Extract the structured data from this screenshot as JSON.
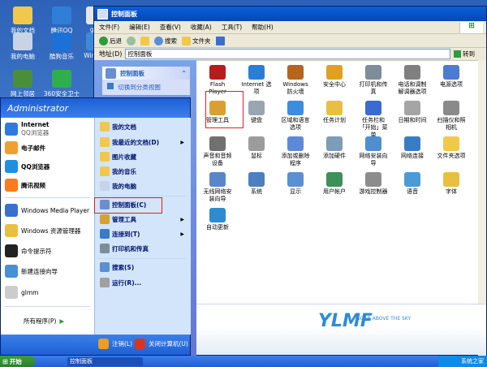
{
  "desktop": {
    "icons": [
      {
        "label": "我的文档",
        "color": "#f1c84b"
      },
      {
        "label": "腾讯QQ",
        "color": "#2f7ed8"
      },
      {
        "label": "我的电脑",
        "color": "#c8d4e6"
      },
      {
        "label": "酷狗音乐",
        "color": "#1a72d6"
      },
      {
        "label": "Window",
        "color": "#3d8ad6"
      },
      {
        "label": "网上邻居",
        "color": "#4a8e3c"
      },
      {
        "label": "360安全卫士",
        "color": "#2fae4e"
      },
      {
        "label": "glm",
        "color": "#e6e6e6"
      }
    ]
  },
  "window": {
    "title": "控制面板",
    "menu": [
      "文件(F)",
      "编辑(E)",
      "查看(V)",
      "收藏(A)",
      "工具(T)",
      "帮助(H)"
    ],
    "toolbar": {
      "back": "后退",
      "search": "搜索",
      "folders": "文件夹"
    },
    "address": {
      "label": "地址(D)",
      "value": "控制面板",
      "go": "转到"
    },
    "taskpane": {
      "title": "控制面板",
      "link": "切换到分类视图"
    },
    "items": [
      {
        "label": "Flash Player",
        "color": "#b71c1c"
      },
      {
        "label": "Internet 选项",
        "color": "#2a7fd4"
      },
      {
        "label": "Windows 防火墙",
        "color": "#b5651d"
      },
      {
        "label": "安全中心",
        "color": "#e0a020"
      },
      {
        "label": "打印机和传真",
        "color": "#7f8c99"
      },
      {
        "label": "电话和调制解调器选项",
        "color": "#808080"
      },
      {
        "label": "电源选项",
        "color": "#4c7bd1"
      },
      {
        "label": "管理工具",
        "color": "#d8a030"
      },
      {
        "label": "键盘",
        "color": "#9aa5b1"
      },
      {
        "label": "区域和语言选项",
        "color": "#3c8de0"
      },
      {
        "label": "任务计划",
        "color": "#e8c040"
      },
      {
        "label": "任务栏和「开始」菜单",
        "color": "#3b6ad0"
      },
      {
        "label": "日期和时间",
        "color": "#a5a5a5"
      },
      {
        "label": "扫描仪和照相机",
        "color": "#8a8a8a"
      },
      {
        "label": "声音和音频设备",
        "color": "#707070"
      },
      {
        "label": "鼠标",
        "color": "#9c9c9c"
      },
      {
        "label": "添加或删除程序",
        "color": "#5d8ad6"
      },
      {
        "label": "添加硬件",
        "color": "#7d9cb8"
      },
      {
        "label": "网络安装向导",
        "color": "#4f8fd0"
      },
      {
        "label": "网络连接",
        "color": "#3a7bc8"
      },
      {
        "label": "文件夹选项",
        "color": "#f0c84a"
      },
      {
        "label": "无线网络安装向导",
        "color": "#5a86c9"
      },
      {
        "label": "系统",
        "color": "#4e7fbe"
      },
      {
        "label": "显示",
        "color": "#5b8fd4"
      },
      {
        "label": "用户帐户",
        "color": "#3e8f5a"
      },
      {
        "label": "游戏控制器",
        "color": "#8c8c8c"
      },
      {
        "label": "语音",
        "color": "#4b9bd6"
      },
      {
        "label": "字体",
        "color": "#e8c040"
      },
      {
        "label": "自动更新",
        "color": "#2f8bd0"
      }
    ],
    "banner": {
      "logo": "YLMF",
      "tagline": "SOAR ABOVE THE SKY"
    }
  },
  "startmenu": {
    "user": "Administrator",
    "left": [
      {
        "label": "Internet",
        "sub": "QQ浏览器",
        "color": "#2d7be0"
      },
      {
        "label": "电子邮件",
        "sub": "",
        "color": "#f0a030"
      },
      {
        "label": "QQ浏览器",
        "sub": "",
        "color": "#1f8fe0"
      },
      {
        "label": "腾讯视频",
        "sub": "",
        "color": "#ff7a1a"
      },
      {
        "label": "Windows Media Player",
        "sub": "",
        "color": "#3a6fcf"
      },
      {
        "label": "Windows 资源管理器",
        "sub": "",
        "color": "#e8c040"
      },
      {
        "label": "命令提示符",
        "sub": "",
        "color": "#222222"
      },
      {
        "label": "新建连接向导",
        "sub": "",
        "color": "#4a8ed4"
      },
      {
        "label": "glmm",
        "sub": "",
        "color": "#cccccc"
      }
    ],
    "all_programs": "所有程序(P)",
    "right": [
      {
        "label": "我的文档",
        "arrow": false,
        "color": "#f1c84b"
      },
      {
        "label": "我最近的文档(D)",
        "arrow": true,
        "color": "#f1c84b"
      },
      {
        "label": "图片收藏",
        "arrow": false,
        "color": "#f1c84b"
      },
      {
        "label": "我的音乐",
        "arrow": false,
        "color": "#f1c84b"
      },
      {
        "label": "我的电脑",
        "arrow": false,
        "color": "#c8d4e6"
      },
      {
        "label": "控制面板(C)",
        "arrow": false,
        "color": "#6a8fd0"
      },
      {
        "label": "管理工具",
        "arrow": true,
        "color": "#d8a030"
      },
      {
        "label": "连接到(T)",
        "arrow": true,
        "color": "#3a7bc8"
      },
      {
        "label": "打印机和传真",
        "arrow": false,
        "color": "#7f8c99"
      },
      {
        "label": "搜索(S)",
        "arrow": false,
        "color": "#5b8fd4"
      },
      {
        "label": "运行(R)...",
        "arrow": false,
        "color": "#a0a0a0"
      }
    ],
    "logoff": "注销(L)",
    "shutdown": "关闭计算机(U)"
  },
  "taskbar": {
    "start": "开始",
    "app": "控制面板"
  },
  "watermark": "系统之家"
}
